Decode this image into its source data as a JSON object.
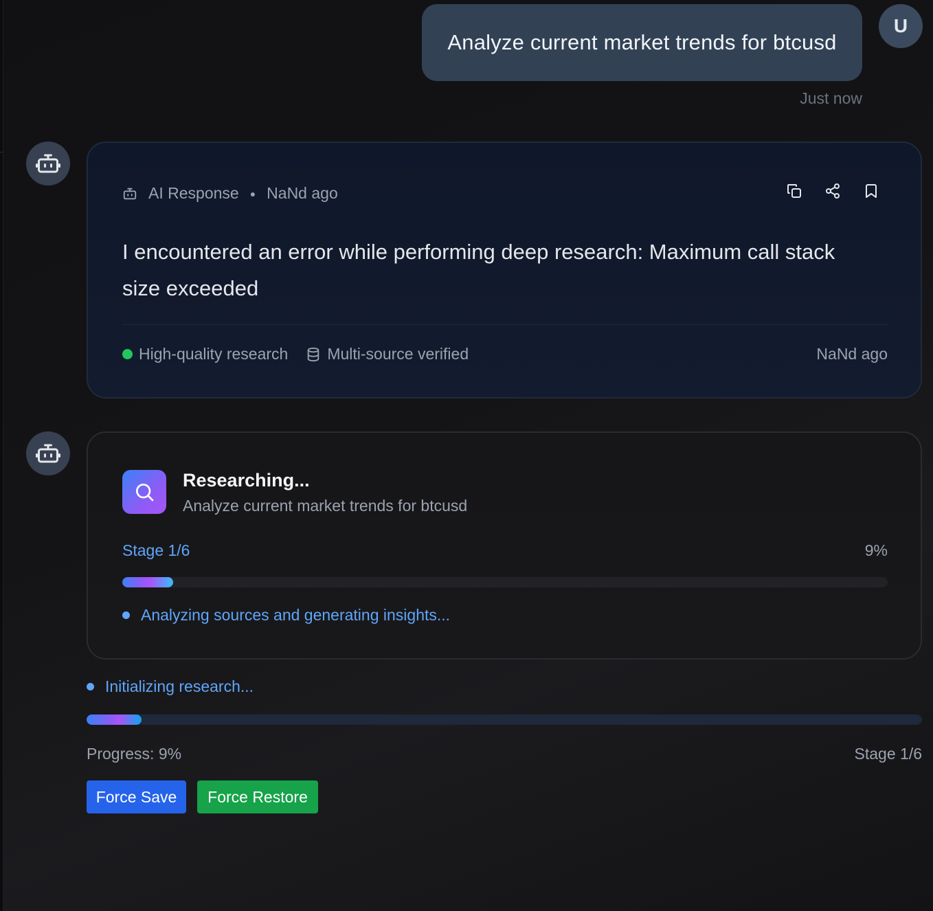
{
  "user_message": {
    "text": "Analyze current market trends for btcusd",
    "avatar_initial": "U",
    "timestamp": "Just now"
  },
  "ai_response": {
    "label": "AI Response",
    "time": "NaNd ago",
    "body": "I encountered an error while performing deep research: Maximum call stack size exceeded",
    "actions": [
      "copy-icon",
      "share-icon",
      "bookmark-icon"
    ],
    "badges": {
      "quality": "High-quality research",
      "sources": "Multi-source verified"
    },
    "footer_time": "NaNd ago"
  },
  "research": {
    "title": "Researching...",
    "query": "Analyze current market trends for btcusd",
    "stage": "Stage 1/6",
    "percent": "9%",
    "progress": 0.09,
    "status": "Analyzing sources and generating insights..."
  },
  "bottom": {
    "status": "Initializing research...",
    "progress_label": "Progress: 9%",
    "stage_label": "Stage 1/6",
    "progress": 0.09
  },
  "buttons": {
    "force_save": "Force Save",
    "force_restore": "Force Restore"
  },
  "colors": {
    "accent_blue": "#60a5fa",
    "save": "#2563eb",
    "restore": "#16a34a",
    "success": "#22c55e"
  }
}
